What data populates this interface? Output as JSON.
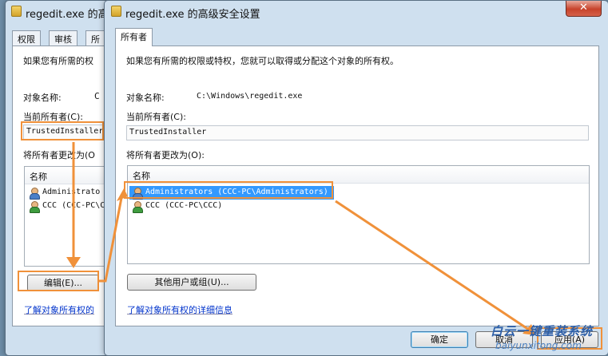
{
  "back_window": {
    "title": "regedit.exe 的高级",
    "tabs": [
      "权限",
      "审核",
      "所"
    ],
    "info_text": "如果您有所需的权",
    "object_name_label": "对象名称:",
    "object_name_value_partial": "C",
    "current_owner_label": "当前所有者(C):",
    "current_owner_value": "TrustedInstaller",
    "change_owner_label": "将所有者更改为(O",
    "list_header": "名称",
    "list_items": [
      "Administrato",
      "CCC (CCC-PC\\C"
    ],
    "edit_button": "编辑(E)...",
    "learn_link": "了解对象所有权的"
  },
  "front_window": {
    "title": "regedit.exe 的高级安全设置",
    "close_glyph": "✕",
    "tab": "所有者",
    "info_text": "如果您有所需的权限或特权，您就可以取得或分配这个对象的所有权。",
    "object_name_label": "对象名称:",
    "object_name_value": "C:\\Windows\\regedit.exe",
    "current_owner_label": "当前所有者(C):",
    "current_owner_value": "TrustedInstaller",
    "change_owner_label": "将所有者更改为(O):",
    "list_header": "名称",
    "list_items": [
      {
        "name": "Administrators (CCC-PC\\Administrators)",
        "icon": "user-group-icon",
        "selected": true
      },
      {
        "name": "CCC (CCC-PC\\CCC)",
        "icon": "user-icon",
        "selected": false
      }
    ],
    "other_users_button": "其他用户或组(U)...",
    "learn_link": "了解对象所有权的详细信息",
    "ok_button": "确定",
    "cancel_button": "取消",
    "apply_button": "应用(A)"
  },
  "watermark": {
    "brand": "白云一键重装系统",
    "url": "baiyunxitong.com"
  },
  "colors": {
    "highlight": "#f0913a",
    "selection": "#3399ff",
    "link": "#0033cc"
  }
}
